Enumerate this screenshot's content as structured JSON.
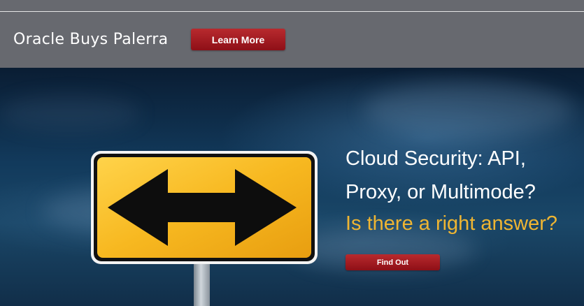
{
  "banner": {
    "text": "Oracle Buys Palerra",
    "button_label": "Learn More"
  },
  "hero": {
    "headline_line1": "Cloud Security: API,",
    "headline_line2": "Proxy, or Multimode?",
    "subline": "Is there a right answer?",
    "button_label": "Find Out"
  },
  "colors": {
    "banner_bg": "#67696f",
    "button_red": "#a01d24",
    "accent_yellow": "#efb532",
    "sign_yellow": "#f7b820"
  },
  "icons": {
    "sign": "double-arrow-road-sign-icon"
  }
}
